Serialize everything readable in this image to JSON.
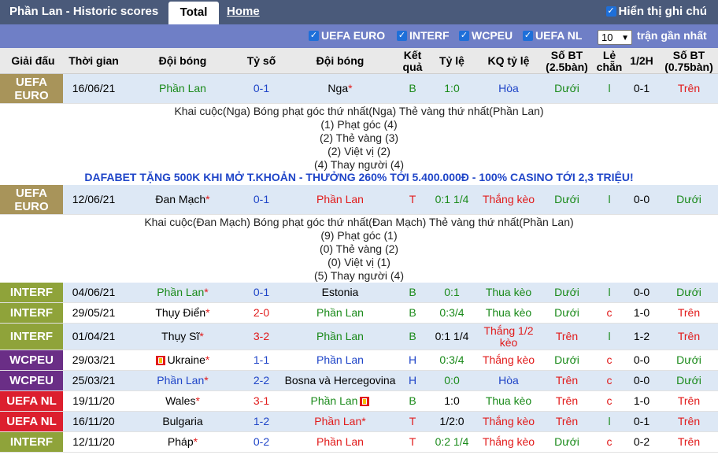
{
  "header": {
    "title": "Phần Lan - Historic scores",
    "tab_total": "Total",
    "tab_home": "Home",
    "show_odds": "Hiển thị ghi chú"
  },
  "filters": {
    "items": [
      "UEFA EURO",
      "INTERF",
      "WCPEU",
      "UEFA NL"
    ],
    "count": "10",
    "recent_label": "trận gần nhất"
  },
  "columns": [
    "Giải đấu",
    "Thời gian",
    "Đội bóng",
    "Tỷ số",
    "Đội bóng",
    "Kết quả",
    "Tỷ lệ",
    "KQ tỷ lệ",
    "Số BT (2.5bàn)",
    "Lẻ chẵn",
    "1/2H",
    "Số BT (0.75bàn)"
  ],
  "colors": {
    "UEFA EURO": "#a8945a",
    "INTERF": "#8fa33a",
    "WCPEU": "#6a2e86",
    "UEFA NL": "#dc1f2e"
  },
  "matches": [
    {
      "league": "UEFA EURO",
      "date": "16/06/21",
      "home": "Phần Lan",
      "home_star": "",
      "score": "0-1",
      "away": "Nga",
      "away_star": "*",
      "result": "B",
      "odds": "1:0",
      "odds_result": "Hòa",
      "ou": "Dưới",
      "oe": "l",
      "half": "0-1",
      "ou2": "Trên"
    },
    {
      "league": "UEFA EURO",
      "date": "12/06/21",
      "home": "Đan Mạch",
      "home_star": "*",
      "score": "0-1",
      "away": "Phần Lan",
      "away_star": "",
      "result": "T",
      "odds": "0:1 1/4",
      "odds_result": "Thắng kèo",
      "ou": "Dưới",
      "oe": "l",
      "half": "0-0",
      "ou2": "Dưới"
    },
    {
      "league": "INTERF",
      "date": "04/06/21",
      "home": "Phần Lan",
      "home_star": "*",
      "score": "0-1",
      "away": "Estonia",
      "away_star": "",
      "result": "B",
      "odds": "0:1",
      "odds_result": "Thua kèo",
      "ou": "Dưới",
      "oe": "l",
      "half": "0-0",
      "ou2": "Dưới"
    },
    {
      "league": "INTERF",
      "date": "29/05/21",
      "home": "Thụy Điển",
      "home_star": "*",
      "score": "2-0",
      "away": "Phần Lan",
      "away_star": "",
      "result": "B",
      "odds": "0:3/4",
      "odds_result": "Thua kèo",
      "ou": "Dưới",
      "oe": "c",
      "half": "1-0",
      "ou2": "Trên"
    },
    {
      "league": "INTERF",
      "date": "01/04/21",
      "home": "Thụy Sĩ",
      "home_star": "*",
      "score": "3-2",
      "away": "Phần Lan",
      "away_star": "",
      "result": "B",
      "odds": "0:1 1/4",
      "odds_result": "Thắng 1/2 kèo",
      "ou": "Trên",
      "oe": "l",
      "half": "1-2",
      "ou2": "Trên"
    },
    {
      "league": "WCPEU",
      "date": "29/03/21",
      "home": "Ukraine",
      "home_star": "*",
      "score": "1-1",
      "away": "Phần Lan",
      "away_star": "",
      "result": "H",
      "odds": "0:3/4",
      "odds_result": "Thắng kèo",
      "ou": "Dưới",
      "oe": "c",
      "half": "0-0",
      "ou2": "Dưới"
    },
    {
      "league": "WCPEU",
      "date": "25/03/21",
      "home": "Phần Lan",
      "home_star": "*",
      "score": "2-2",
      "away": "Bosna và Hercegovina",
      "away_star": "",
      "result": "H",
      "odds": "0:0",
      "odds_result": "Hòa",
      "ou": "Trên",
      "oe": "c",
      "half": "0-0",
      "ou2": "Dưới"
    },
    {
      "league": "UEFA NL",
      "date": "19/11/20",
      "home": "Wales",
      "home_star": "*",
      "score": "3-1",
      "away": "Phần Lan",
      "away_star": "",
      "result": "B",
      "odds": "1:0",
      "odds_result": "Thua kèo",
      "ou": "Trên",
      "oe": "c",
      "half": "1-0",
      "ou2": "Trên"
    },
    {
      "league": "UEFA NL",
      "date": "16/11/20",
      "home": "Bulgaria",
      "home_star": "",
      "score": "1-2",
      "away": "Phần Lan",
      "away_star": "*",
      "result": "T",
      "odds": "1/2:0",
      "odds_result": "Thắng kèo",
      "ou": "Trên",
      "oe": "l",
      "half": "0-1",
      "ou2": "Trên"
    },
    {
      "league": "INTERF",
      "date": "12/11/20",
      "home": "Pháp",
      "home_star": "*",
      "score": "0-2",
      "away": "Phần Lan",
      "away_star": "",
      "result": "T",
      "odds": "0:2 1/4",
      "odds_result": "Thắng kèo",
      "ou": "Dưới",
      "oe": "c",
      "half": "0-2",
      "ou2": "Trên"
    }
  ],
  "details": [
    {
      "line1": "Khai cuộc(Nga)   Bóng phạt góc thứ nhất(Nga)   Thẻ vàng thứ nhất(Phần Lan)",
      "stats": [
        "(1) Phạt góc (4)",
        "(2) Thẻ vàng (3)",
        "(2) Việt vị (2)",
        "(4) Thay người (4)"
      ]
    },
    {
      "line1": "Khai cuộc(Đan Mạch)   Bóng phạt góc thứ nhất(Đan Mạch)   Thẻ vàng thứ nhất(Phần Lan)",
      "stats": [
        "(9) Phạt góc (1)",
        "(0) Thẻ vàng (2)",
        "(0) Việt vị (1)",
        "(5) Thay người (4)"
      ]
    }
  ],
  "ad_text": "DAFABET TẶNG 500K KHI MỞ T.KHOẢN - THƯỞNG 260% TỚI 5.400.000Đ - 100% CASINO TỚI 2,3 TRIỆU!"
}
